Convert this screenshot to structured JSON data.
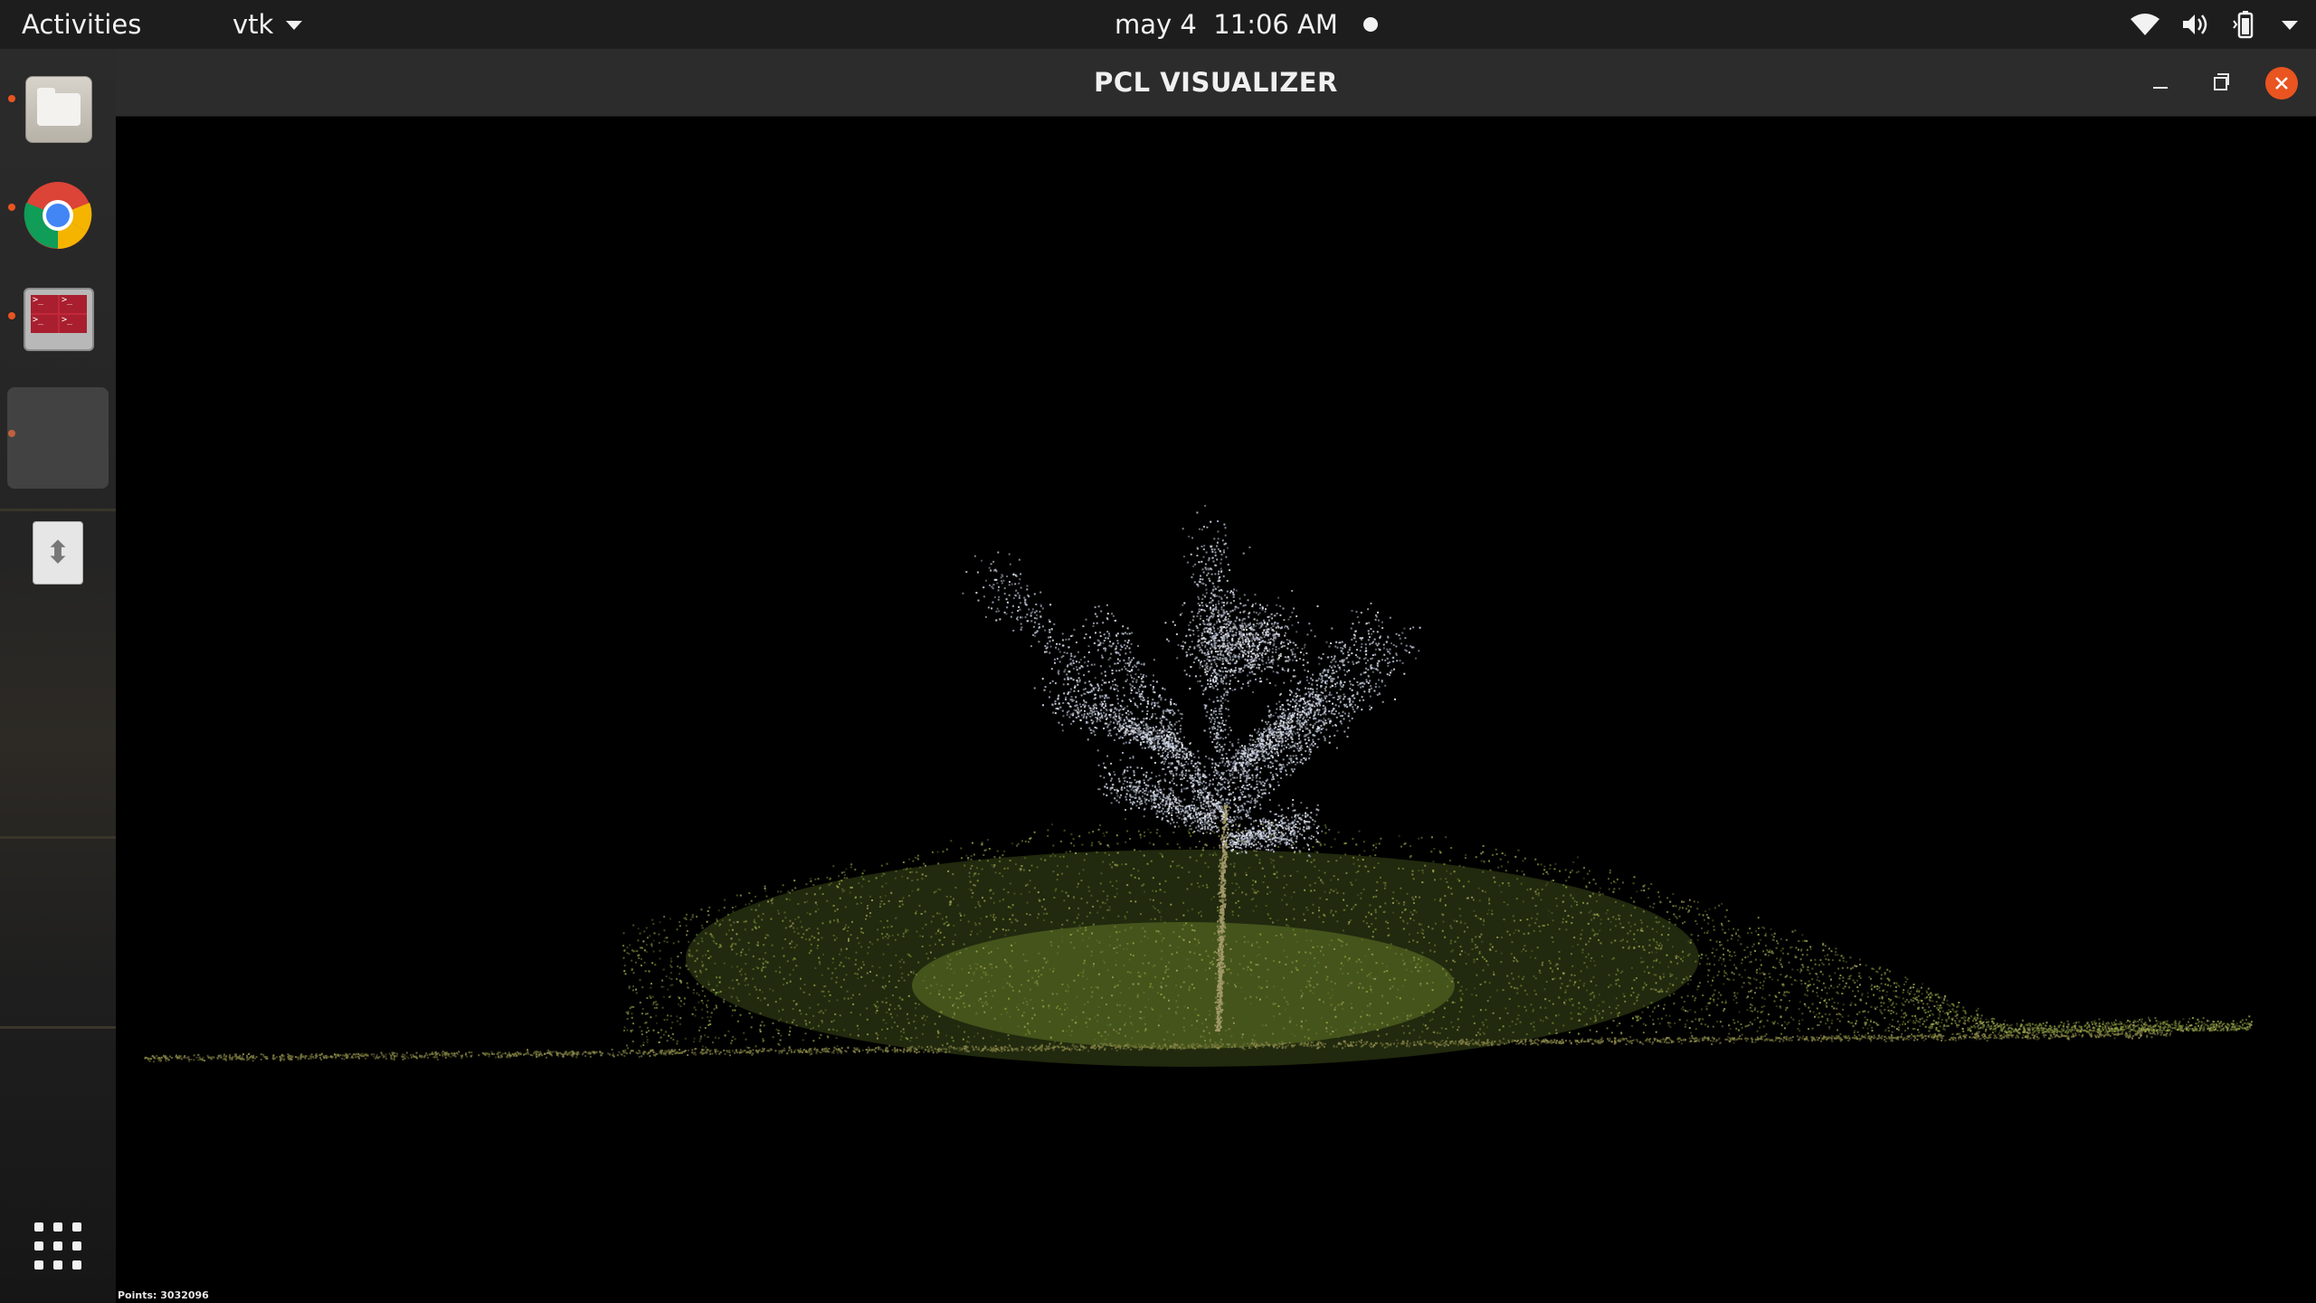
{
  "topbar": {
    "activities": "Activities",
    "app_menu": "vtk",
    "date": "may 4",
    "time": "11:06 AM",
    "icons": [
      "wifi-icon",
      "volume-icon",
      "battery-icon",
      "system-menu-caret-icon"
    ]
  },
  "dock": {
    "items": [
      {
        "name": "files",
        "icon": "files-icon",
        "running": true
      },
      {
        "name": "chrome",
        "icon": "chrome-icon",
        "running": true
      },
      {
        "name": "terminal",
        "icon": "terminal-icon",
        "running": true
      },
      {
        "name": "pcl-visualizer",
        "icon": "window-icon",
        "running": true
      },
      {
        "name": "usb-drive",
        "icon": "usb-icon",
        "running": false
      }
    ],
    "show_apps_icon": "apps-grid-icon",
    "accent_color": "#e95420"
  },
  "window": {
    "title": "PCL VISUALIZER",
    "close_color": "#e95420"
  },
  "viewport": {
    "points_label": "Points: 3032096",
    "background": "#000000",
    "scene": "point-cloud-tree"
  }
}
